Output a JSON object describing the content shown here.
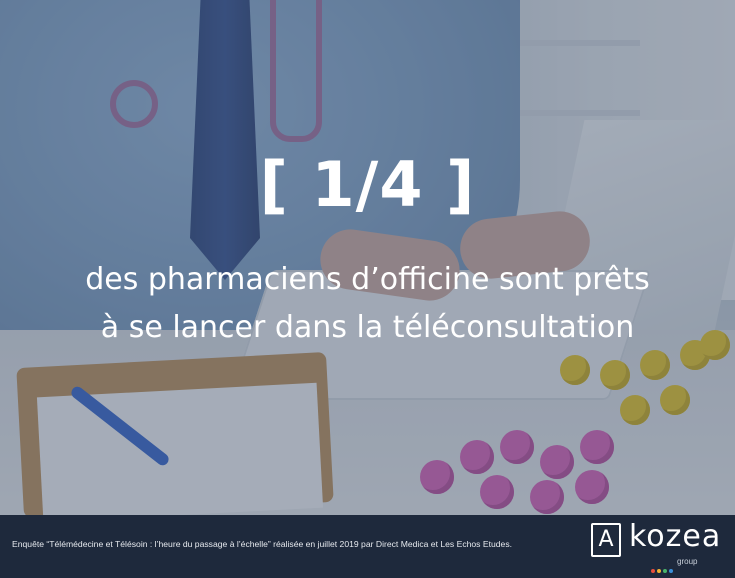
{
  "headline": {
    "stat": "[ 1/4 ]"
  },
  "caption": {
    "line1": "des pharmaciens d’officine sont prêts",
    "line2": "à se lancer dans la téléconsultation"
  },
  "footer": {
    "source": "Enquête “Télémédecine et Télésoin : l’heure du passage à l’échelle”  réalisée en juillet 2019 par Direct Medica et Les Echos Etudes.",
    "logo": {
      "letter": "A",
      "word": "kozea",
      "sub": "group",
      "dot_colors": [
        "#e94f3d",
        "#f2b233",
        "#49b56b",
        "#3a8fd9"
      ]
    }
  },
  "colors": {
    "footer_bg": "#1e293c",
    "text": "#ffffff"
  }
}
